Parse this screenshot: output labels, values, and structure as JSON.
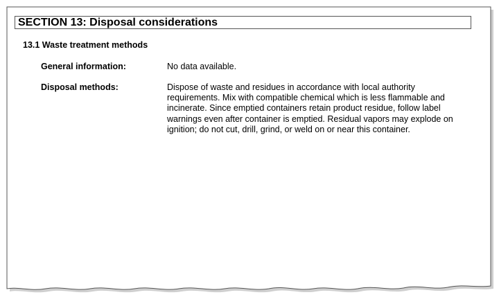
{
  "section": {
    "title": "SECTION 13: Disposal considerations"
  },
  "subsection": {
    "title": "13.1 Waste treatment methods"
  },
  "fields": {
    "general": {
      "label": "General information:",
      "value": "No data available."
    },
    "disposal": {
      "label": "Disposal methods:",
      "lines": [
        "Dispose of waste and residues in accordance with local authority",
        "requirements. Mix with compatible chemical which is less flammable and",
        "incinerate. Since emptied containers retain product residue, follow label",
        "warnings even after container is emptied. Residual vapors may explode on",
        "ignition; do not cut, drill, grind, or weld on or near this container."
      ]
    }
  },
  "colors": {
    "page_bg": "#ffffff",
    "frame_bg": "#e6e6e6",
    "border": "#555555"
  }
}
